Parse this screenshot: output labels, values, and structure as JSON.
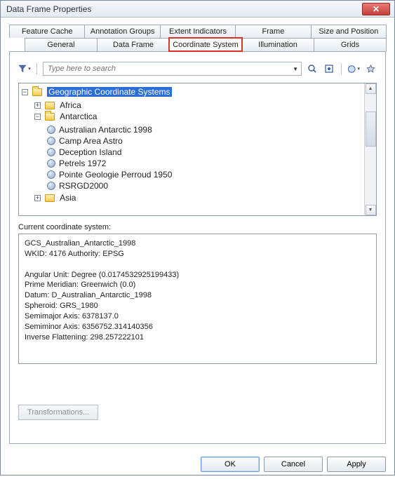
{
  "window": {
    "title": "Data Frame Properties"
  },
  "tabs": {
    "row1": [
      "Feature Cache",
      "Annotation Groups",
      "Extent Indicators",
      "Frame",
      "Size and Position"
    ],
    "row2": [
      "General",
      "Data Frame",
      "Coordinate System",
      "Illumination",
      "Grids"
    ],
    "active": "Coordinate System"
  },
  "search": {
    "placeholder": "Type here to search"
  },
  "tree": {
    "root": {
      "label": "Geographic Coordinate Systems"
    },
    "africa": "Africa",
    "antarctica": "Antarctica",
    "antarctica_children": [
      "Australian Antarctic 1998",
      "Camp Area Astro",
      "Deception Island",
      "Petrels 1972",
      "Pointe Geologie Perroud 1950",
      "RSRGD2000"
    ],
    "asia": "Asia"
  },
  "currentLabel": "Current coordinate system:",
  "details": "GCS_Australian_Antarctic_1998\nWKID: 4176 Authority: EPSG\n\nAngular Unit: Degree (0.0174532925199433)\nPrime Meridian: Greenwich (0.0)\nDatum: D_Australian_Antarctic_1998\n  Spheroid: GRS_1980\n    Semimajor Axis: 6378137.0\n    Semiminor Axis: 6356752.314140356\n    Inverse Flattening: 298.257222101",
  "buttons": {
    "transform": "Transformations...",
    "ok": "OK",
    "cancel": "Cancel",
    "apply": "Apply"
  }
}
